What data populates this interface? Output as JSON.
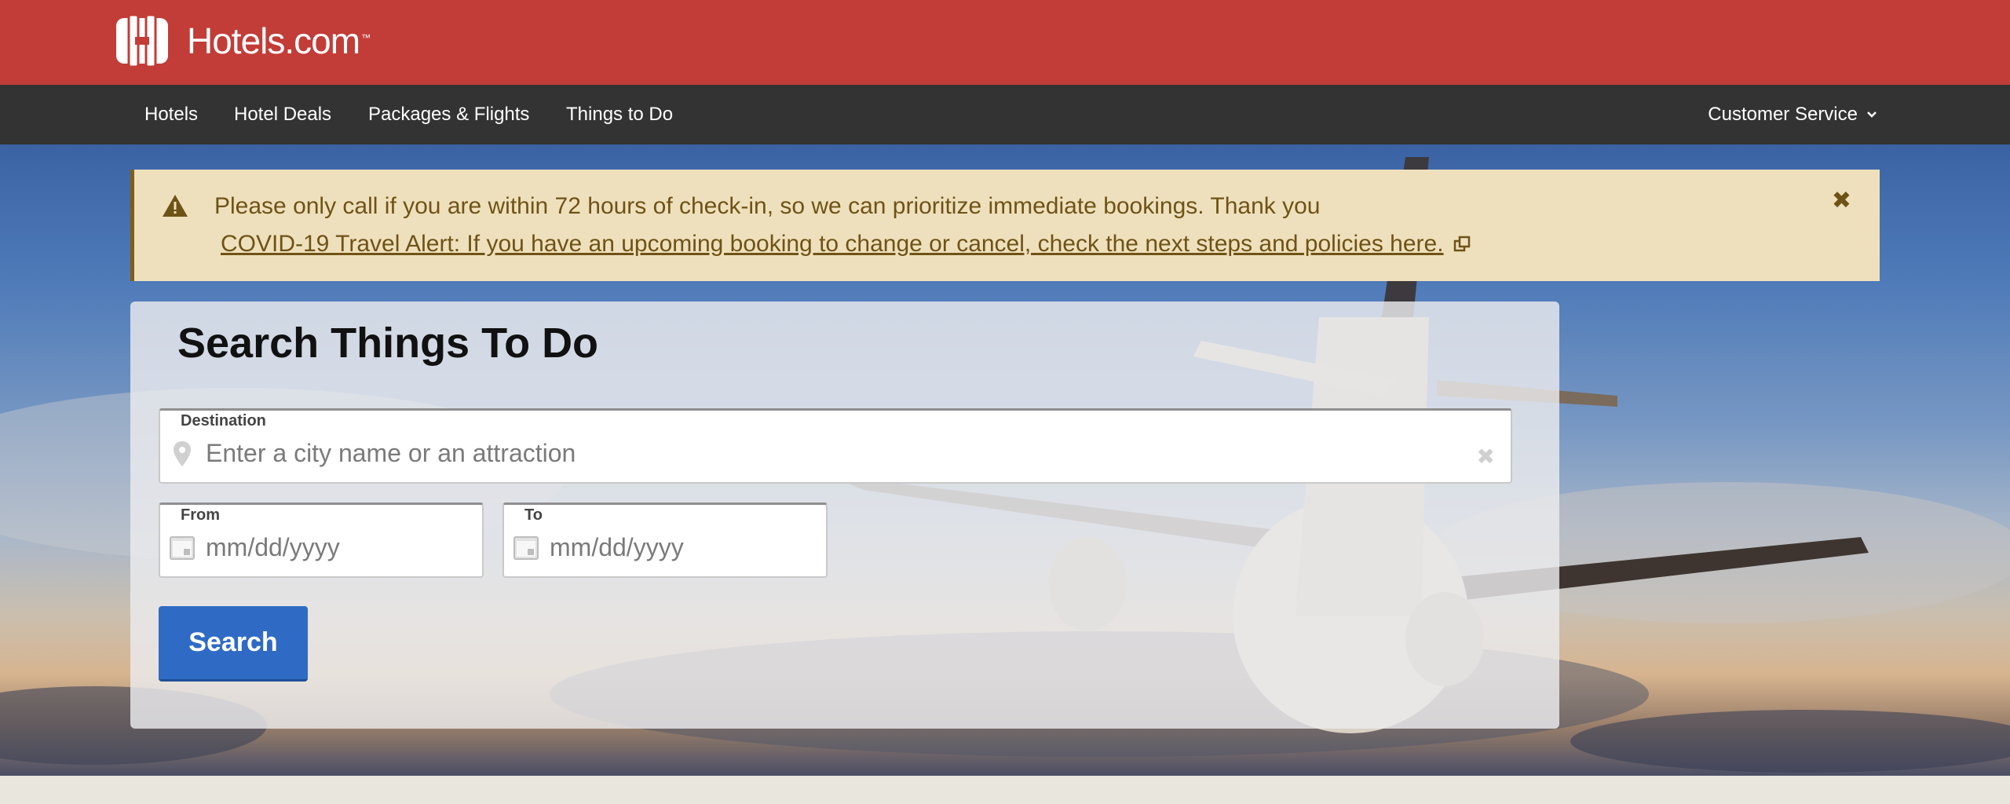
{
  "brand": {
    "name": "Hotels.com",
    "trademark": "™",
    "header_color": "#c23d38"
  },
  "nav": {
    "items": [
      {
        "label": "Hotels"
      },
      {
        "label": "Hotel Deals"
      },
      {
        "label": "Packages & Flights"
      },
      {
        "label": "Things to Do"
      }
    ],
    "customer_service": "Customer Service",
    "customer_service_icon": "chevron-down-icon"
  },
  "alert": {
    "icon": "warning-icon",
    "message": "Please only call if you are within 72 hours of check-in, so we can prioritize immediate bookings. Thank you",
    "link_text": "COVID-19 Travel Alert: If you have an upcoming booking to change or cancel, check the next steps and policies here.",
    "link_icon": "external-link-icon",
    "close_icon": "close-icon",
    "background": "#efe0bd",
    "text_color": "#6e5316"
  },
  "search": {
    "title": "Search Things To Do",
    "destination": {
      "label": "Destination",
      "placeholder": "Enter a city name or an attraction",
      "icon": "map-pin-icon"
    },
    "from": {
      "label": "From",
      "placeholder": "mm/dd/yyyy",
      "icon": "calendar-icon"
    },
    "to": {
      "label": "To",
      "placeholder": "mm/dd/yyyy",
      "icon": "calendar-icon"
    },
    "button_label": "Search",
    "button_color": "#2f6bc4"
  }
}
